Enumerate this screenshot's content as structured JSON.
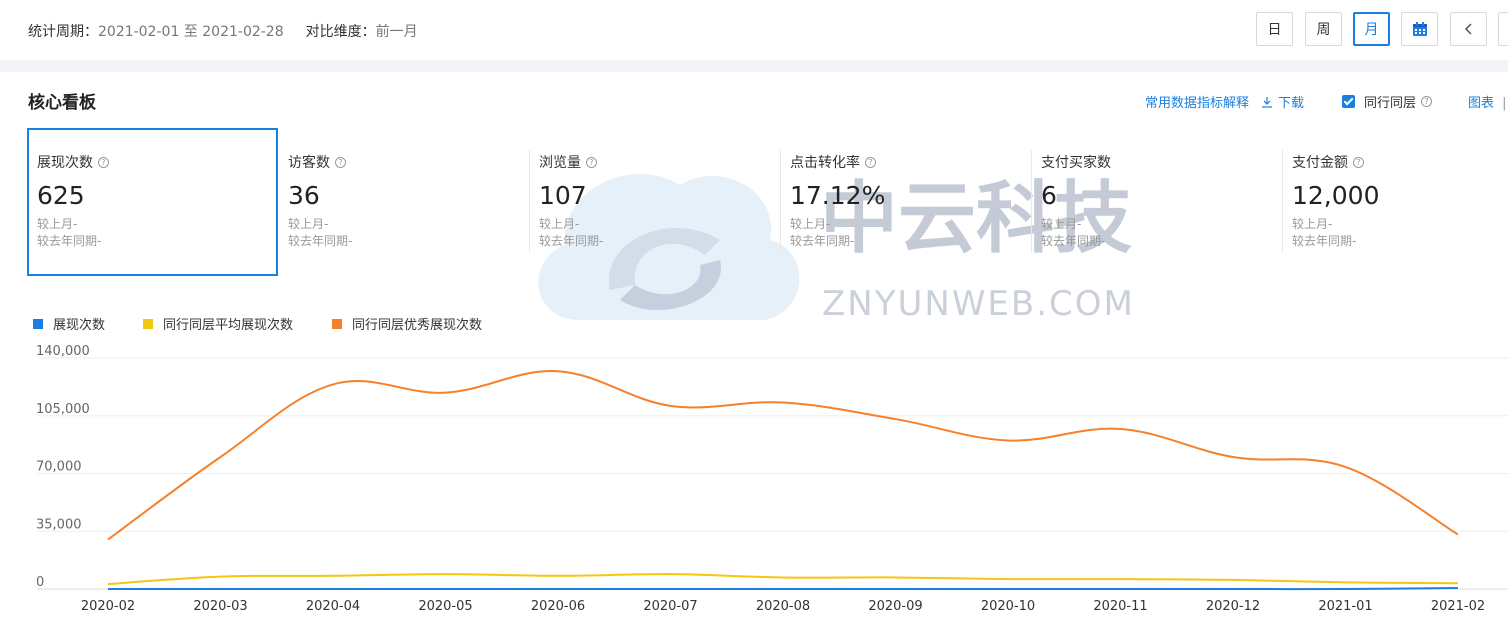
{
  "topbar": {
    "period_label": "统计周期：",
    "period_value": "2021-02-01 至 2021-02-28",
    "compare_label": "对比维度：",
    "compare_value": "前一月",
    "btn_day": "日",
    "btn_week": "周",
    "btn_month": "月"
  },
  "card": {
    "title": "核心看板",
    "explain_link": "常用数据指标解释",
    "download": "下载",
    "peer_label": "同行同层",
    "chart_link": "图表",
    "chart_sep": "|"
  },
  "metrics": [
    {
      "label": "展现次数",
      "value": "625",
      "mom": "较上月-",
      "yoy": "较去年同期-"
    },
    {
      "label": "访客数",
      "value": "36",
      "mom": "较上月-",
      "yoy": "较去年同期-"
    },
    {
      "label": "浏览量",
      "value": "107",
      "mom": "较上月-",
      "yoy": "较去年同期-"
    },
    {
      "label": "点击转化率",
      "value": "17.12%",
      "mom": "较上月-",
      "yoy": "较去年同期-"
    },
    {
      "label": "支付买家数",
      "value": "6",
      "mom": "较上月-",
      "yoy": "较去年同期-"
    },
    {
      "label": "支付金额",
      "value": "12,000",
      "mom": "较上月-",
      "yoy": "较去年同期-"
    }
  ],
  "watermark": {
    "cn": "中云科技",
    "en": "ZNYUNWEB.COM"
  },
  "colors": {
    "accent": "#1a7fe0",
    "series1": "#1a7fe0",
    "series2": "#f2c811",
    "series3": "#f5812c"
  },
  "chart_data": {
    "type": "line",
    "categories": [
      "2020-02",
      "2020-03",
      "2020-04",
      "2020-05",
      "2020-06",
      "2020-07",
      "2020-08",
      "2020-09",
      "2020-10",
      "2020-11",
      "2020-12",
      "2021-01",
      "2021-02"
    ],
    "yticks": [
      "140,000",
      "105,000",
      "70,000",
      "35,000",
      "0"
    ],
    "ylim": [
      0,
      140000
    ],
    "grid": true,
    "legend_position": "top-left",
    "series": [
      {
        "name": "展现次数",
        "color": "#1a7fe0",
        "values": [
          0,
          0,
          0,
          0,
          0,
          0,
          0,
          0,
          0,
          0,
          0,
          0,
          625
        ]
      },
      {
        "name": "同行同层平均展现次数",
        "color": "#f2c811",
        "values": [
          3000,
          7500,
          8000,
          9000,
          8000,
          9000,
          7000,
          7000,
          6000,
          6000,
          5500,
          4000,
          3500
        ]
      },
      {
        "name": "同行同层优秀展现次数",
        "color": "#f5812c",
        "values": [
          30000,
          80000,
          124000,
          119000,
          132000,
          111000,
          113000,
          103000,
          90000,
          97000,
          80000,
          74000,
          33000
        ]
      }
    ]
  }
}
